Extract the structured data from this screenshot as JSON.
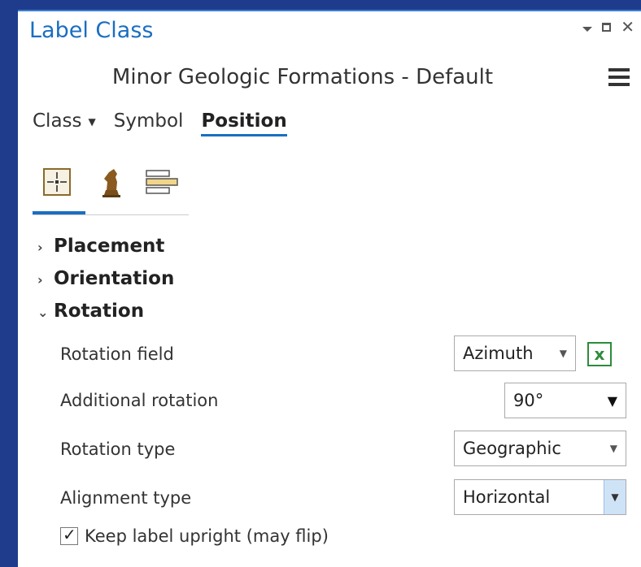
{
  "window": {
    "title": "Label Class",
    "controls": {
      "pin": "pin-dropdown-icon",
      "maximize": "maximize-icon",
      "close": "✕"
    }
  },
  "header": {
    "layer_name": "Minor Geologic Formations - Default"
  },
  "tabs": [
    {
      "label": "Class",
      "has_dropdown": true,
      "active": false
    },
    {
      "label": "Symbol",
      "active": false
    },
    {
      "label": "Position",
      "active": true
    }
  ],
  "subtabs": [
    {
      "icon": "placement-icon",
      "active": true
    },
    {
      "icon": "conflict-resolution-icon",
      "active": false
    },
    {
      "icon": "label-stack-icon",
      "active": false
    }
  ],
  "sections": {
    "placement": {
      "label": "Placement",
      "expanded": false
    },
    "orientation": {
      "label": "Orientation",
      "expanded": false
    },
    "rotation": {
      "label": "Rotation",
      "expanded": true
    }
  },
  "rotation": {
    "rotation_field": {
      "label": "Rotation field",
      "value": "Azimuth"
    },
    "additional_rotation": {
      "label": "Additional rotation",
      "value": "90°"
    },
    "rotation_type": {
      "label": "Rotation type",
      "value": "Geographic"
    },
    "alignment_type": {
      "label": "Alignment type",
      "value": "Horizontal"
    },
    "keep_upright": {
      "label": "Keep label upright (may flip)",
      "checked": true
    }
  },
  "colors": {
    "accent": "#1b6ec2",
    "frame": "#1f3c8c",
    "expression_green": "#2c8c3a"
  }
}
